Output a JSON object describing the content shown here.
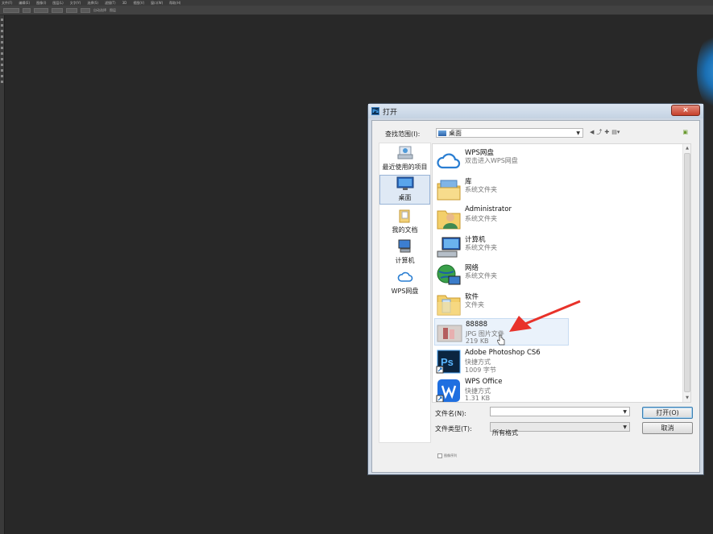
{
  "ps_menu": [
    "文件(F)",
    "编辑(E)",
    "图像(I)",
    "图层(L)",
    "文字(Y)",
    "选择(S)",
    "滤镜(T)",
    "3D",
    "视图(V)",
    "窗口(W)",
    "帮助(H)"
  ],
  "ps_options": {
    "auto_select": "自动选择",
    "layer": "图层"
  },
  "dialog": {
    "title": "打开",
    "close_label": "×",
    "look_in_label": "查找范围(I):",
    "look_in_value": "桌面",
    "places": [
      {
        "label": "最近使用的项目",
        "icon": "recent-icon"
      },
      {
        "label": "桌面",
        "icon": "desktop-icon",
        "selected": true
      },
      {
        "label": "我的文档",
        "icon": "documents-icon"
      },
      {
        "label": "计算机",
        "icon": "computer-icon"
      },
      {
        "label": "WPS网盘",
        "icon": "cloud-icon"
      }
    ],
    "files": [
      {
        "name": "WPS网盘",
        "sub1": "双击进入WPS网盘",
        "sub2": "",
        "icon": "cloud-icon"
      },
      {
        "name": "库",
        "sub1": "系统文件夹",
        "sub2": "",
        "icon": "library-icon"
      },
      {
        "name": "Administrator",
        "sub1": "系统文件夹",
        "sub2": "",
        "icon": "user-folder-icon"
      },
      {
        "name": "计算机",
        "sub1": "系统文件夹",
        "sub2": "",
        "icon": "computer-icon"
      },
      {
        "name": "网络",
        "sub1": "系统文件夹",
        "sub2": "",
        "icon": "network-icon"
      },
      {
        "name": "软件",
        "sub1": "文件夹",
        "sub2": "",
        "icon": "folder-icon"
      },
      {
        "name": "88888",
        "sub1": "JPG 图片文件",
        "sub2": "219 KB",
        "icon": "image-thumbnail-icon",
        "highlighted": true
      },
      {
        "name": "Adobe Photoshop CS6",
        "sub1": "快捷方式",
        "sub2": "1009 字节",
        "icon": "photoshop-icon"
      },
      {
        "name": "WPS Office",
        "sub1": "快捷方式",
        "sub2": "1.31 KB",
        "icon": "wps-icon"
      }
    ],
    "filename_label": "文件名(N):",
    "filename_value": "",
    "filetype_label": "文件类型(T):",
    "filetype_value": "所有格式",
    "open_button": "打开(O)",
    "cancel_button": "取消",
    "sequence_label": "图像序列"
  },
  "colors": {
    "annotation_arrow": "#e8322a",
    "ps_background": "#282828"
  }
}
